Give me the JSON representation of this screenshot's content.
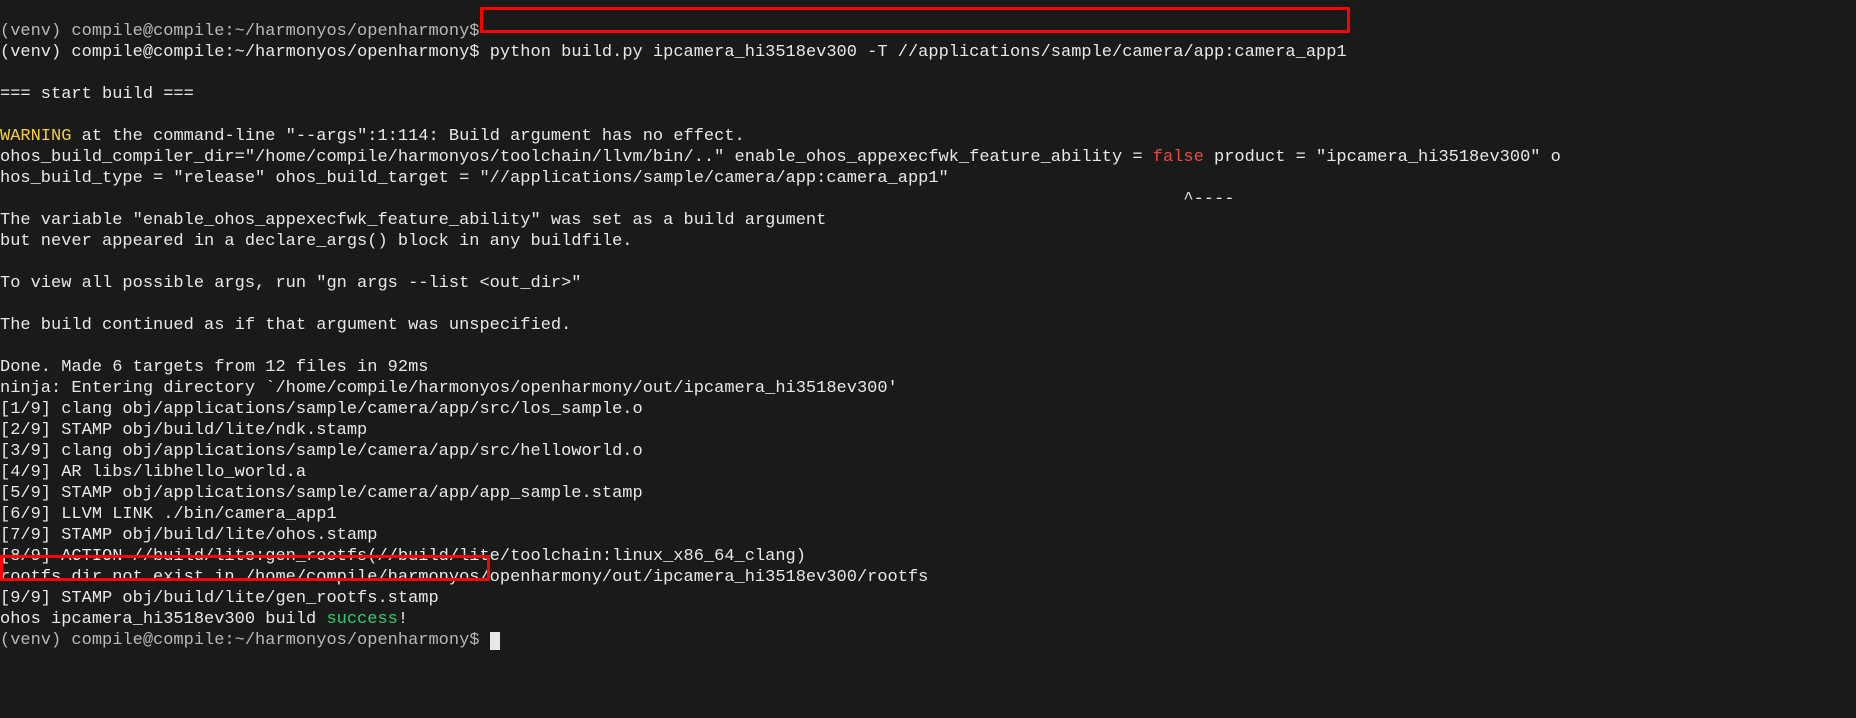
{
  "line0": "(venv) compile@compile:~/harmonyos/openharmony$",
  "prompt": {
    "venv": "(venv) ",
    "userhost": "compile@compile",
    "colon": ":",
    "path": "~/harmonyos/openharmony",
    "dollar": "$ "
  },
  "command": "python build.py ipcamera_hi3518ev300 -T //applications/sample/camera/app:camera_app1",
  "blank": "",
  "start_build": "=== start build ===",
  "warn_label": "WARNING",
  "warn_rest": " at the command-line \"--args\":1:114: Build argument has no effect.",
  "line_args1a": "ohos_build_compiler_dir=\"/home/compile/harmonyos/toolchain/llvm/bin/..\" enable_ohos_appexecfwk_feature_ability = ",
  "false_token": "false",
  "line_args1b": " product = \"ipcamera_hi3518ev300\" o",
  "line_args2": "hos_build_type = \"release\" ohos_build_target = \"//applications/sample/camera/app:camera_app1\"",
  "caret_line": "                                                                                                                    ^----",
  "var_line1": "The variable \"enable_ohos_appexecfwk_feature_ability\" was set as a build argument",
  "var_line2": "but never appeared in a declare_args() block in any buildfile.",
  "view_args": "To view all possible args, run \"gn args --list <out_dir>\"",
  "build_cont": "The build continued as if that argument was unspecified.",
  "done_line": "Done. Made 6 targets from 12 files in 92ms",
  "ninja_line": "ninja: Entering directory `/home/compile/harmonyos/openharmony/out/ipcamera_hi3518ev300'",
  "steps": [
    "[1/9] clang obj/applications/sample/camera/app/src/los_sample.o",
    "[2/9] STAMP obj/build/lite/ndk.stamp",
    "[3/9] clang obj/applications/sample/camera/app/src/helloworld.o",
    "[4/9] AR libs/libhello_world.a",
    "[5/9] STAMP obj/applications/sample/camera/app/app_sample.stamp",
    "[6/9] LLVM LINK ./bin/camera_app1",
    "[7/9] STAMP obj/build/lite/ohos.stamp",
    "[8/9] ACTION //build/lite:gen_rootfs(//build/lite/toolchain:linux_x86_64_clang)"
  ],
  "rootfs_line": "rootfs dir not exist in /home/compile/harmonyos/openharmony/out/ipcamera_hi3518ev300/rootfs",
  "step9": "[9/9] STAMP obj/build/lite/gen_rootfs.stamp",
  "success_pre": "ohos ipcamera_hi3518ev300 build ",
  "success_word": "success",
  "success_excl": "!",
  "final_prompt": "(venv) compile@compile:~/harmonyos/openharmony$ "
}
